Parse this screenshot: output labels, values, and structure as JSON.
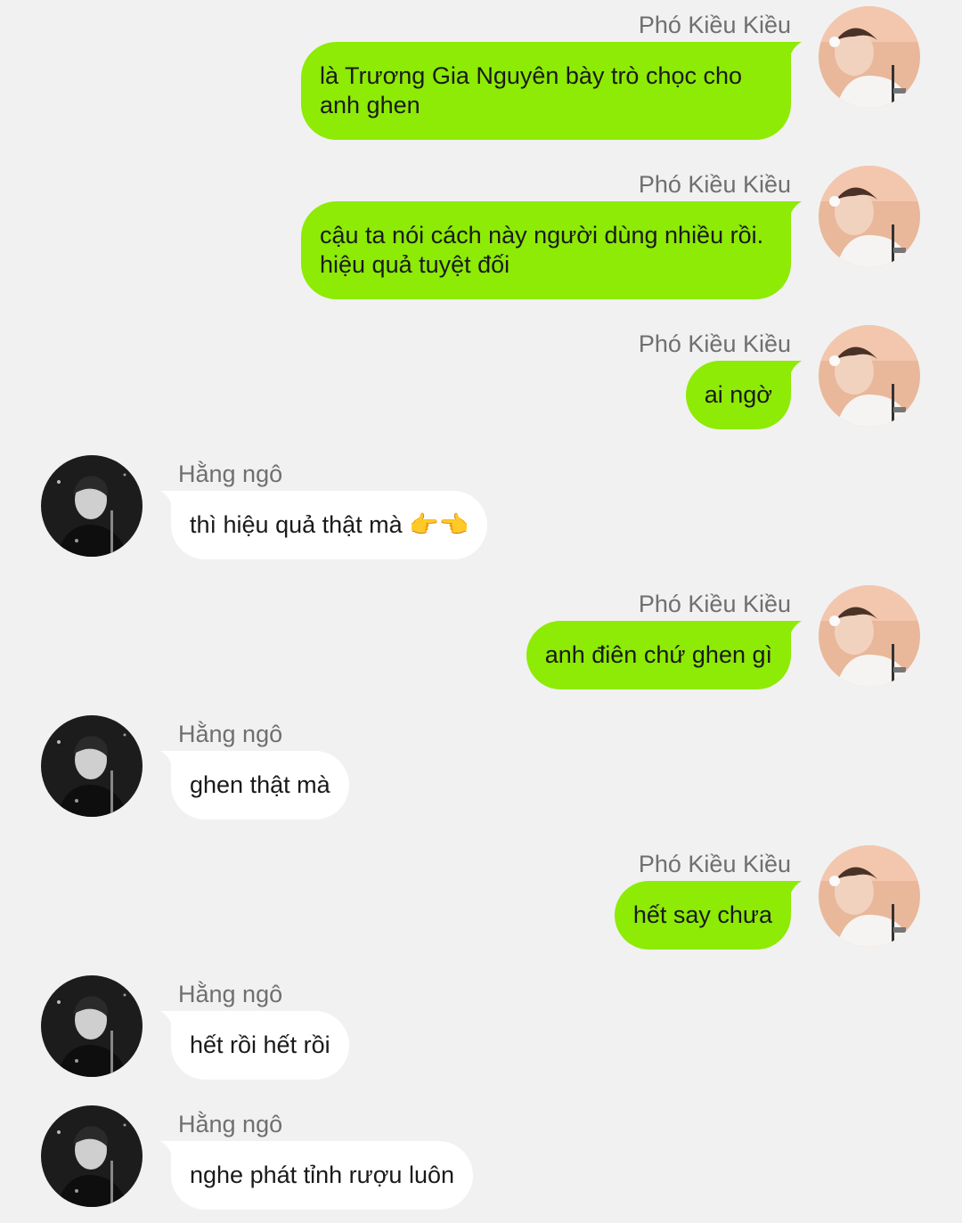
{
  "colors": {
    "background": "#f1f1f1",
    "outgoing_bubble": "#8deb05",
    "incoming_bubble": "#ffffff",
    "sender_name": "#6f6f6f"
  },
  "contacts": {
    "me": {
      "name": "Phó Kiều Kiều",
      "avatar_icon": "color-photo-avatar"
    },
    "other": {
      "name": "Hằng ngô",
      "avatar_icon": "grayscale-photo-avatar"
    }
  },
  "messages": [
    {
      "sender": "Phó Kiều Kiều",
      "direction": "out",
      "lines": [
        "là Trương Gia Nguyên bày trò chọc cho",
        "anh ghen"
      ]
    },
    {
      "sender": "Phó Kiều Kiều",
      "direction": "out",
      "lines": [
        "cậu ta nói cách này người dùng nhiều rồi.",
        "hiệu quả tuyệt đối"
      ]
    },
    {
      "sender": "Phó Kiều Kiều",
      "direction": "out",
      "lines": [
        "ai ngờ"
      ]
    },
    {
      "sender": "Hằng ngô",
      "direction": "in",
      "lines": [
        "thì hiệu quả thật mà"
      ],
      "emoji": "👉👈"
    },
    {
      "sender": "Phó Kiều Kiều",
      "direction": "out",
      "lines": [
        "anh điên chứ ghen gì"
      ]
    },
    {
      "sender": "Hằng ngô",
      "direction": "in",
      "lines": [
        "ghen thật mà"
      ]
    },
    {
      "sender": "Phó Kiều Kiều",
      "direction": "out",
      "lines": [
        "hết say chưa"
      ]
    },
    {
      "sender": "Hằng ngô",
      "direction": "in",
      "lines": [
        "hết rồi hết rồi"
      ]
    },
    {
      "sender": "Hằng ngô",
      "direction": "in",
      "lines": [
        "nghe phát tỉnh rượu luôn"
      ]
    }
  ]
}
